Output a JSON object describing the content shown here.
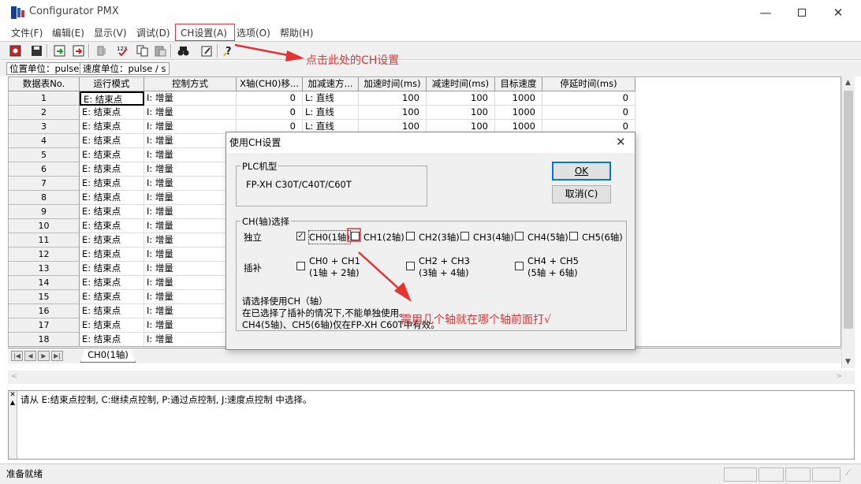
{
  "window": {
    "title": "Configurator PMX"
  },
  "menu": [
    "文件(F)",
    "编辑(E)",
    "显示(V)",
    "调试(D)",
    "CH设置(A)",
    "选项(O)",
    "帮助(H)"
  ],
  "units": {
    "position": "位置单位：pulse",
    "speed": "速度单位：pulse / s"
  },
  "grid": {
    "columns": [
      "数据表No.",
      "运行模式",
      "控制方式",
      "X轴(CH0)移...",
      "加减速方...",
      "加速时间(ms)",
      "减速时间(ms)",
      "目标速度",
      "停延时间(ms)"
    ],
    "rows": [
      [
        "1",
        "E: 结束点",
        "I: 增量",
        "0",
        "L: 直线",
        "100",
        "100",
        "1000",
        "0"
      ],
      [
        "2",
        "E: 结束点",
        "I: 增量",
        "0",
        "L: 直线",
        "100",
        "100",
        "1000",
        "0"
      ],
      [
        "3",
        "E: 结束点",
        "I: 增量",
        "0",
        "L: 直线",
        "100",
        "100",
        "1000",
        "0"
      ],
      [
        "4",
        "E: 结束点",
        "I: 增量",
        "",
        "",
        "",
        "",
        "",
        ""
      ],
      [
        "5",
        "E: 结束点",
        "I: 增量",
        "",
        "",
        "",
        "",
        "",
        ""
      ],
      [
        "6",
        "E: 结束点",
        "I: 增量",
        "",
        "",
        "",
        "",
        "",
        ""
      ],
      [
        "7",
        "E: 结束点",
        "I: 增量",
        "",
        "",
        "",
        "",
        "",
        ""
      ],
      [
        "8",
        "E: 结束点",
        "I: 增量",
        "",
        "",
        "",
        "",
        "",
        ""
      ],
      [
        "9",
        "E: 结束点",
        "I: 增量",
        "",
        "",
        "",
        "",
        "",
        ""
      ],
      [
        "10",
        "E: 结束点",
        "I: 增量",
        "",
        "",
        "",
        "",
        "",
        ""
      ],
      [
        "11",
        "E: 结束点",
        "I: 增量",
        "",
        "",
        "",
        "",
        "",
        ""
      ],
      [
        "12",
        "E: 结束点",
        "I: 增量",
        "",
        "",
        "",
        "",
        "",
        ""
      ],
      [
        "13",
        "E: 结束点",
        "I: 增量",
        "",
        "",
        "",
        "",
        "",
        ""
      ],
      [
        "14",
        "E: 结束点",
        "I: 增量",
        "",
        "",
        "",
        "",
        "",
        ""
      ],
      [
        "15",
        "E: 结束点",
        "I: 增量",
        "",
        "",
        "",
        "",
        "",
        ""
      ],
      [
        "16",
        "E: 结束点",
        "I: 增量",
        "",
        "",
        "",
        "",
        "",
        ""
      ],
      [
        "17",
        "E: 结束点",
        "I: 增量",
        "",
        "",
        "",
        "",
        "",
        ""
      ],
      [
        "18",
        "E: 结束点",
        "I: 增量",
        "",
        "",
        "",
        "",
        "",
        ""
      ]
    ],
    "sheet_tab": "CH0(1轴)"
  },
  "hint": "请从 E:结束点控制, C:继续点控制, P:通过点控制, J:速度点控制 中选择。",
  "status": "准备就绪",
  "dialog": {
    "title": "使用CH设置",
    "plc_group": "PLC机型",
    "plc_model": "FP-XH C30T/C40T/C60T",
    "ok": "OK",
    "cancel": "取消(C)",
    "ch_group": "CH(轴)选择",
    "independent_label": "独立",
    "interp_label": "插补",
    "independent": [
      {
        "label": "CH0(1轴)",
        "checked": true
      },
      {
        "label": "CH1(2轴)",
        "checked": false
      },
      {
        "label": "CH2(3轴)",
        "checked": false
      },
      {
        "label": "CH3(4轴)",
        "checked": false
      },
      {
        "label": "CH4(5轴)",
        "checked": false
      },
      {
        "label": "CH5(6轴)",
        "checked": false
      }
    ],
    "interp": [
      {
        "line1": "CH0 + CH1",
        "line2": "(1轴 + 2轴)",
        "checked": false
      },
      {
        "line1": "CH2 + CH3",
        "line2": "(3轴 + 4轴)",
        "checked": false
      },
      {
        "line1": "CH4 + CH5",
        "line2": "(5轴 + 6轴)",
        "checked": false
      }
    ],
    "note1": "请选择使用CH（轴）",
    "note2": "在已选择了插补的情况下,不能单独使用。",
    "note3": "CH4(5轴)、CH5(6轴)仅在FP-XH C60T中有效。"
  },
  "annotations": {
    "menu_note": "点击此处的CH设置",
    "axis_note": "需用几个轴就在哪个轴前面打√",
    "color": "#e53333"
  }
}
